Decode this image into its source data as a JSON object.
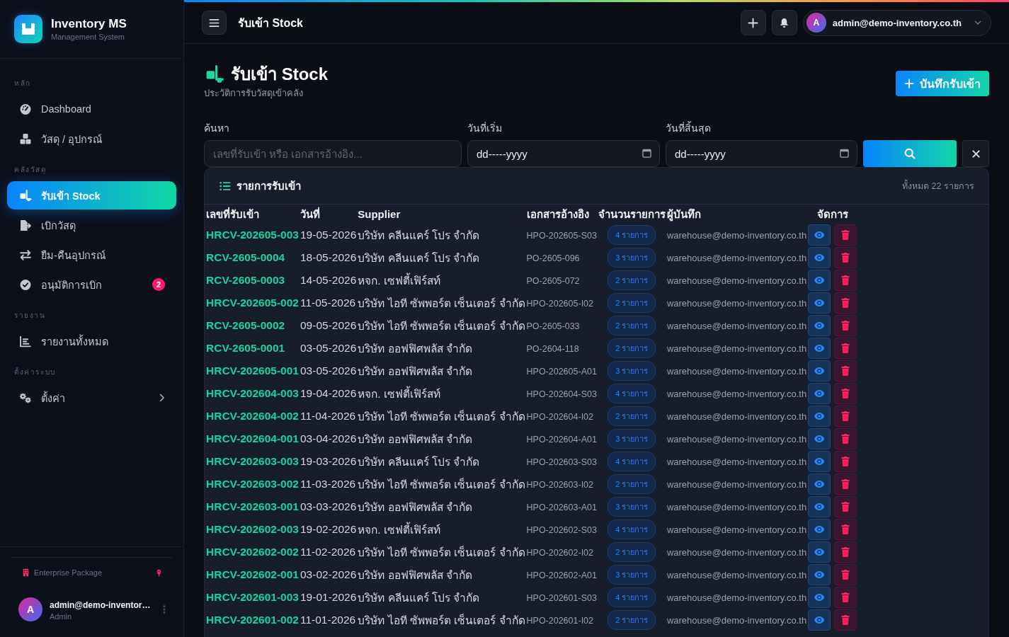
{
  "sidebar": {
    "brand": {
      "title": "Inventory MS",
      "subtitle": "Management System"
    },
    "sections": [
      {
        "heading": "หลัก",
        "items": [
          {
            "label": "Dashboard",
            "kind": "link",
            "selected": false
          },
          {
            "label": "วัสดุ / อุปกรณ์",
            "kind": "link",
            "selected": false
          }
        ]
      },
      {
        "heading": "คลังวัสดุ",
        "items": [
          {
            "label": "รับเข้า Stock",
            "kind": "link",
            "selected": true
          },
          {
            "label": "เบิกวัสดุ",
            "kind": "link",
            "selected": false
          },
          {
            "label": "ยืม-คืนอุปกรณ์",
            "kind": "link",
            "selected": false
          },
          {
            "label": "อนุมัติการเบิก",
            "kind": "link",
            "selected": false,
            "badge": "2"
          }
        ]
      },
      {
        "heading": "รายงาน",
        "items": [
          {
            "label": "รายงานทั้งหมด",
            "kind": "link",
            "selected": false
          }
        ]
      },
      {
        "heading": "ตั้งค่าระบบ",
        "items": [
          {
            "label": "ตั้งค่า",
            "kind": "submenu",
            "selected": false
          }
        ]
      }
    ],
    "package": {
      "label": "Enterprise Package"
    },
    "user": {
      "avatar": "A",
      "name": "admin@demo-inventor…",
      "role": "Admin"
    }
  },
  "topbar": {
    "title": "รับเข้า Stock",
    "user": {
      "avatar": "A",
      "email": "admin@demo-inventory.co.th"
    }
  },
  "page": {
    "title": "รับเข้า Stock",
    "subtitle": "ประวัติการรับวัสดุเข้าคลัง",
    "primary_button": "บันทึกรับเข้า"
  },
  "filters": [
    {
      "kind": "text",
      "label": "ค้นหา",
      "placeholder": "เลขที่รับเข้า หรือ เอกสารอ้างอิง..."
    },
    {
      "kind": "date",
      "label": "วันที่เริ่ม",
      "placeholder": "dd-----yyyy"
    },
    {
      "kind": "date",
      "label": "วันที่สิ้นสุด",
      "placeholder": "dd-----yyyy"
    }
  ],
  "table": {
    "title": "รายการรับเข้า",
    "total": "ทั้งหมด 22 รายการ",
    "columns": [
      "เลขที่รับเข้า",
      "วันที่",
      "Supplier",
      "เอกสารอ้างอิง",
      "จำนวนรายการ",
      "ผู้บันทึก",
      "จัดการ"
    ],
    "rows": [
      {
        "number": "HRCV-202605-003",
        "date": "19-05-2026",
        "supplier": "บริษัท คลีนแคร์ โปร จำกัด",
        "reference": "HPO-202605-S03",
        "items": "4 รายการ",
        "recorder": "warehouse@demo-inventory.co.th"
      },
      {
        "number": "RCV-2605-0004",
        "date": "18-05-2026",
        "supplier": "บริษัท คลีนแคร์ โปร จำกัด",
        "reference": "PO-2605-096",
        "items": "3 รายการ",
        "recorder": "warehouse@demo-inventory.co.th"
      },
      {
        "number": "RCV-2605-0003",
        "date": "14-05-2026",
        "supplier": "หจก. เซฟตี้เฟิร์สท์",
        "reference": "PO-2605-072",
        "items": "2 รายการ",
        "recorder": "warehouse@demo-inventory.co.th"
      },
      {
        "number": "HRCV-202605-002",
        "date": "11-05-2026",
        "supplier": "บริษัท ไอที ซัพพอร์ต เซ็นเตอร์ จำกัด",
        "reference": "HPO-202605-I02",
        "items": "2 รายการ",
        "recorder": "warehouse@demo-inventory.co.th"
      },
      {
        "number": "RCV-2605-0002",
        "date": "09-05-2026",
        "supplier": "บริษัท ไอที ซัพพอร์ต เซ็นเตอร์ จำกัด",
        "reference": "PO-2605-033",
        "items": "2 รายการ",
        "recorder": "warehouse@demo-inventory.co.th"
      },
      {
        "number": "RCV-2605-0001",
        "date": "03-05-2026",
        "supplier": "บริษัท ออฟฟิศพลัส จำกัด",
        "reference": "PO-2604-118",
        "items": "2 รายการ",
        "recorder": "warehouse@demo-inventory.co.th"
      },
      {
        "number": "HRCV-202605-001",
        "date": "03-05-2026",
        "supplier": "บริษัท ออฟฟิศพลัส จำกัด",
        "reference": "HPO-202605-A01",
        "items": "3 รายการ",
        "recorder": "warehouse@demo-inventory.co.th"
      },
      {
        "number": "HRCV-202604-003",
        "date": "19-04-2026",
        "supplier": "หจก. เซฟตี้เฟิร์สท์",
        "reference": "HPO-202604-S03",
        "items": "4 รายการ",
        "recorder": "warehouse@demo-inventory.co.th"
      },
      {
        "number": "HRCV-202604-002",
        "date": "11-04-2026",
        "supplier": "บริษัท ไอที ซัพพอร์ต เซ็นเตอร์ จำกัด",
        "reference": "HPO-202604-I02",
        "items": "2 รายการ",
        "recorder": "warehouse@demo-inventory.co.th"
      },
      {
        "number": "HRCV-202604-001",
        "date": "03-04-2026",
        "supplier": "บริษัท ออฟฟิศพลัส จำกัด",
        "reference": "HPO-202604-A01",
        "items": "3 รายการ",
        "recorder": "warehouse@demo-inventory.co.th"
      },
      {
        "number": "HRCV-202603-003",
        "date": "19-03-2026",
        "supplier": "บริษัท คลีนแคร์ โปร จำกัด",
        "reference": "HPO-202603-S03",
        "items": "4 รายการ",
        "recorder": "warehouse@demo-inventory.co.th"
      },
      {
        "number": "HRCV-202603-002",
        "date": "11-03-2026",
        "supplier": "บริษัท ไอที ซัพพอร์ต เซ็นเตอร์ จำกัด",
        "reference": "HPO-202603-I02",
        "items": "2 รายการ",
        "recorder": "warehouse@demo-inventory.co.th"
      },
      {
        "number": "HRCV-202603-001",
        "date": "03-03-2026",
        "supplier": "บริษัท ออฟฟิศพลัส จำกัด",
        "reference": "HPO-202603-A01",
        "items": "3 รายการ",
        "recorder": "warehouse@demo-inventory.co.th"
      },
      {
        "number": "HRCV-202602-003",
        "date": "19-02-2026",
        "supplier": "หจก. เซฟตี้เฟิร์สท์",
        "reference": "HPO-202602-S03",
        "items": "4 รายการ",
        "recorder": "warehouse@demo-inventory.co.th"
      },
      {
        "number": "HRCV-202602-002",
        "date": "11-02-2026",
        "supplier": "บริษัท ไอที ซัพพอร์ต เซ็นเตอร์ จำกัด",
        "reference": "HPO-202602-I02",
        "items": "2 รายการ",
        "recorder": "warehouse@demo-inventory.co.th"
      },
      {
        "number": "HRCV-202602-001",
        "date": "03-02-2026",
        "supplier": "บริษัท ออฟฟิศพลัส จำกัด",
        "reference": "HPO-202602-A01",
        "items": "3 รายการ",
        "recorder": "warehouse@demo-inventory.co.th"
      },
      {
        "number": "HRCV-202601-003",
        "date": "19-01-2026",
        "supplier": "บริษัท คลีนแคร์ โปร จำกัด",
        "reference": "HPO-202601-S03",
        "items": "4 รายการ",
        "recorder": "warehouse@demo-inventory.co.th"
      },
      {
        "number": "HRCV-202601-002",
        "date": "11-01-2026",
        "supplier": "บริษัท ไอที ซัพพอร์ต เซ็นเตอร์ จำกัด",
        "reference": "HPO-202601-I02",
        "items": "2 รายการ",
        "recorder": "warehouse@demo-inventory.co.th"
      }
    ]
  }
}
